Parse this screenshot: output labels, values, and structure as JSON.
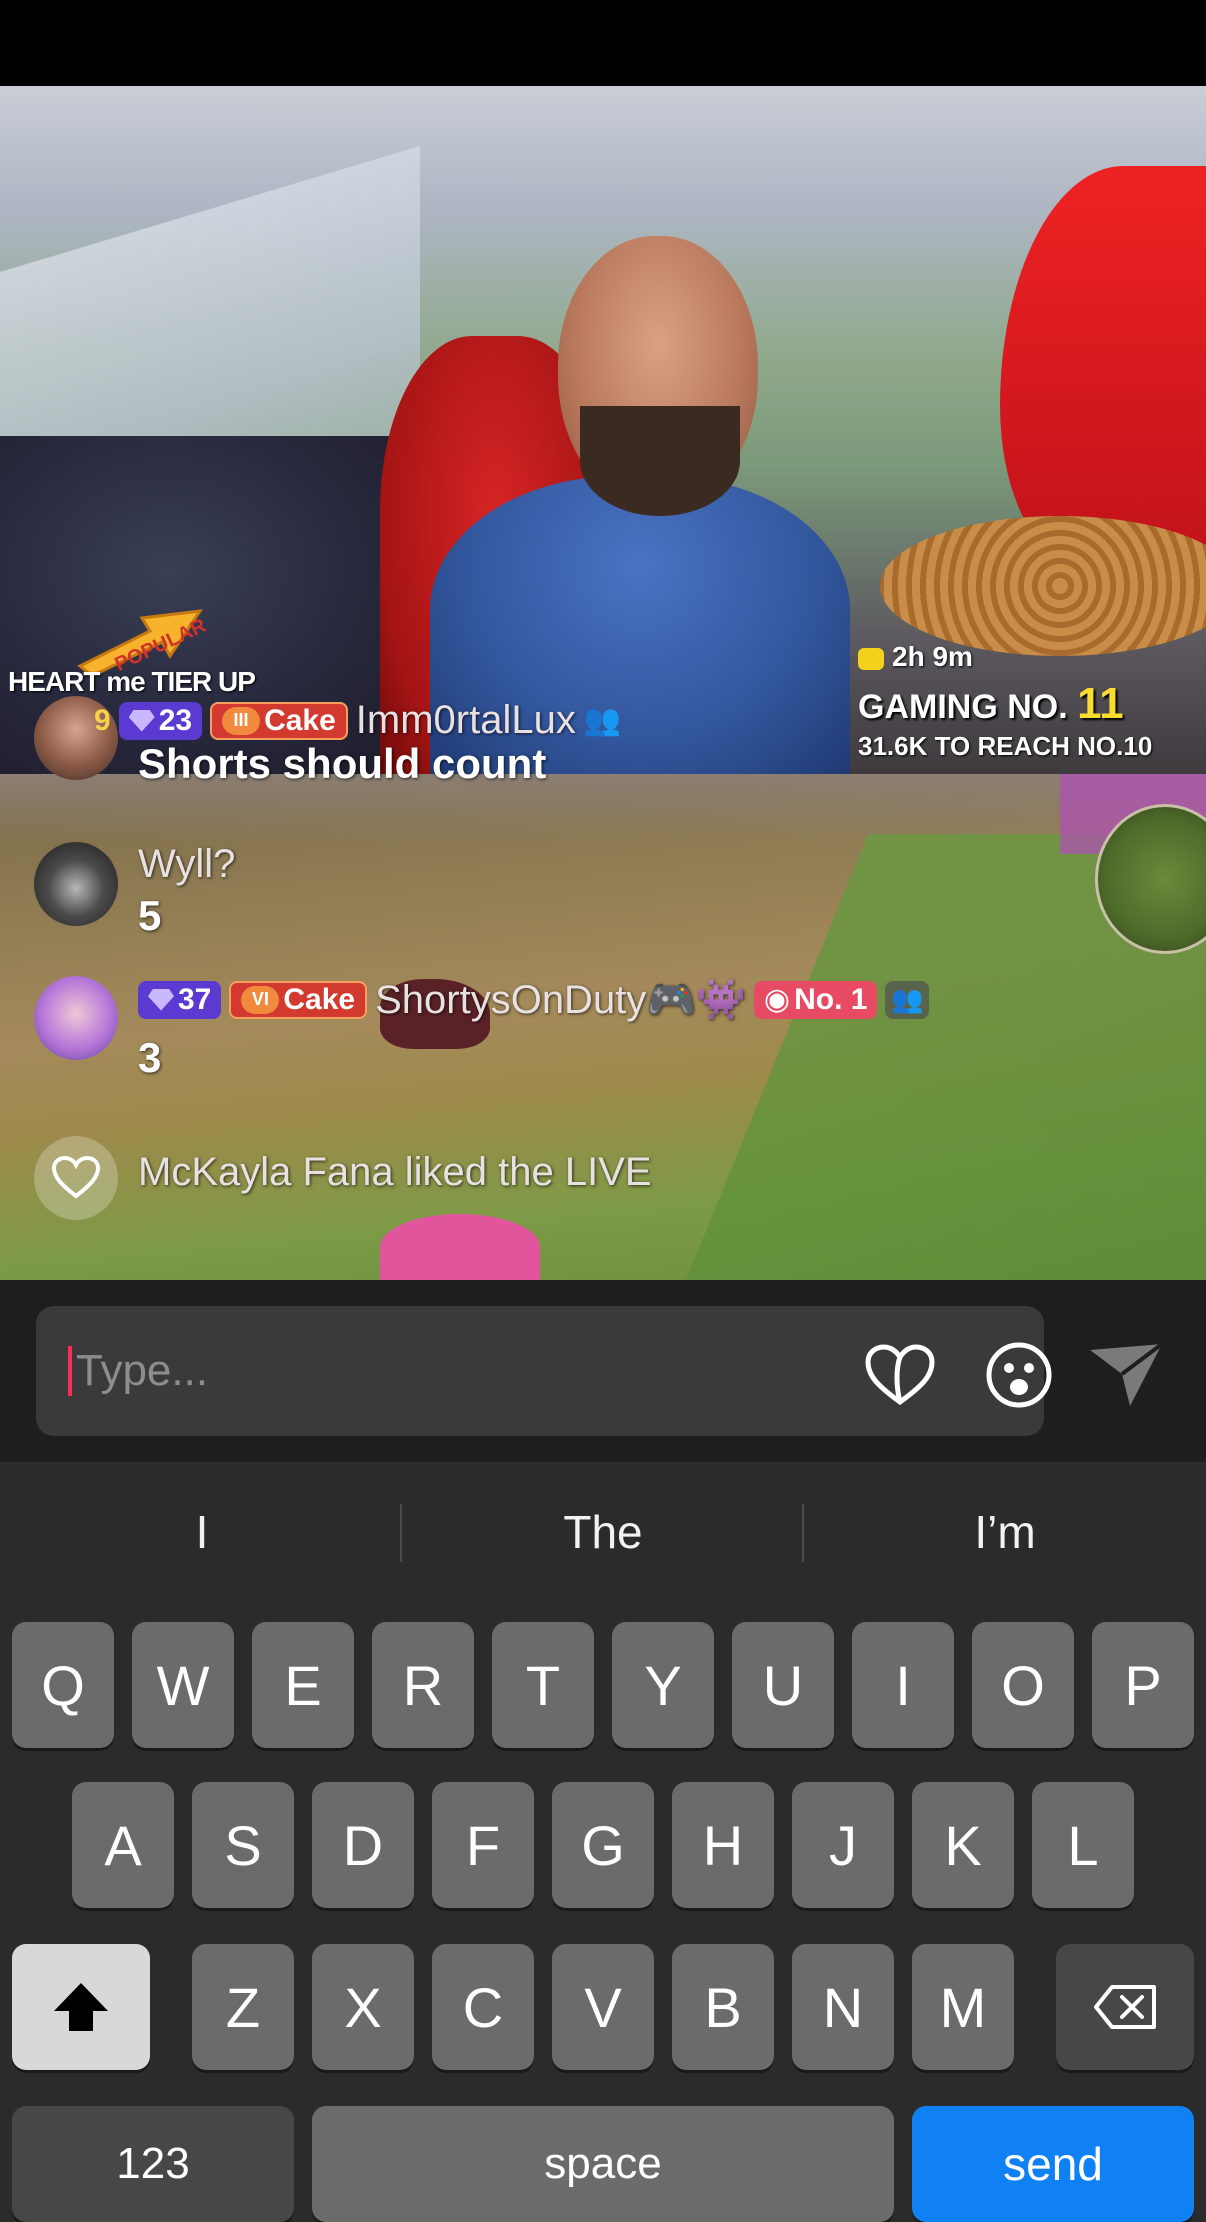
{
  "stream": {
    "tier_label": "HEART me TIER UP",
    "popular_label": "POPULAR",
    "timer": "2h 9m",
    "rank_prefix": "GAMING NO.",
    "rank_number": "11",
    "reach_text": "31.6K TO REACH NO.10"
  },
  "chat": [
    {
      "badges": {
        "level": "23",
        "cake_tier": "III",
        "cake_label": "Cake",
        "partial_prefix": "9"
      },
      "username": "Imm0rtalLux",
      "message": "Shorts should count",
      "avatar": "female-avatar"
    },
    {
      "username": "Wyll?",
      "message": "5",
      "avatar": "gamer-avatar"
    },
    {
      "badges": {
        "level": "37",
        "cake_tier": "VI",
        "cake_label": "Cake",
        "rank_label": "No. 1"
      },
      "username": "ShortysOnDuty🎮👾",
      "message": "3",
      "avatar": "pink-hair-avatar"
    },
    {
      "notice": "McKayla Fana liked the LIVE",
      "icon": "heart-icon"
    }
  ],
  "input": {
    "placeholder": "Type..."
  },
  "keyboard": {
    "suggestions": [
      "I",
      "The",
      "I’m"
    ],
    "row1": [
      "Q",
      "W",
      "E",
      "R",
      "T",
      "Y",
      "U",
      "I",
      "O",
      "P"
    ],
    "row2": [
      "A",
      "S",
      "D",
      "F",
      "G",
      "H",
      "J",
      "K",
      "L"
    ],
    "row3": [
      "Z",
      "X",
      "C",
      "V",
      "B",
      "N",
      "M"
    ],
    "numbers_label": "123",
    "space_label": "space",
    "send_label": "send"
  },
  "colors": {
    "send_key": "#1081f5",
    "caret": "#ff2d55",
    "level_badge": "#5b3ad1",
    "cake_badge": "#d33a2f",
    "rank_badge": "#e74a63",
    "rank_number": "#f8dc2e"
  }
}
